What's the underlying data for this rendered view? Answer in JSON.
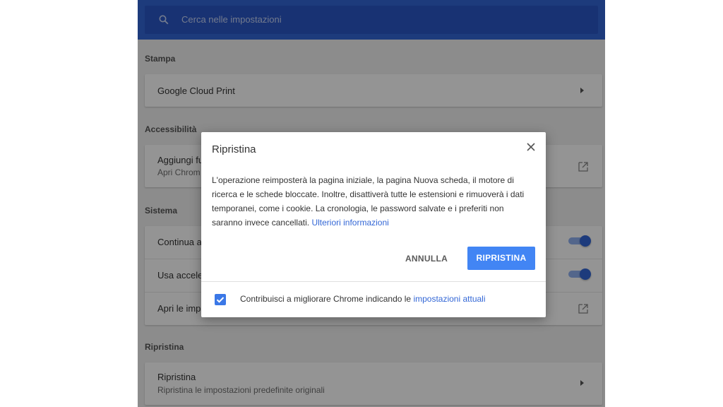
{
  "search": {
    "placeholder": "Cerca nelle impostazioni",
    "icon": "search-icon"
  },
  "sections": {
    "stampa": {
      "title": "Stampa",
      "rows": [
        {
          "label": "Google Cloud Print"
        }
      ]
    },
    "accessibilita": {
      "title": "Accessibilità",
      "rows": [
        {
          "label": "Aggiungi fu",
          "sub": "Apri Chrom"
        }
      ]
    },
    "sistema": {
      "title": "Sistema",
      "rows": [
        {
          "label": "Continua a"
        },
        {
          "label": "Usa accele"
        },
        {
          "label": "Apri le imp"
        }
      ]
    },
    "ripristina": {
      "title": "Ripristina",
      "rows": [
        {
          "label": "Ripristina",
          "sub": "Ripristina le impostazioni predefinite originali"
        }
      ]
    }
  },
  "dialog": {
    "title": "Ripristina",
    "body_lines": [
      "L'operazione reimposterà la pagina iniziale, la pagina Nuova scheda, il motore di",
      "ricerca e le schede bloccate. Inoltre, disattiverà tutte le estensioni e rimuoverà i dati",
      "temporanei, come i cookie. La cronologia, le password salvate e i preferiti non",
      "saranno invece cancellati."
    ],
    "learn_more": "Ulteriori informazioni",
    "cancel_label": "ANNULLA",
    "confirm_label": "RIPRISTINA",
    "checkbox_text": "Contribuisci a migliorare Chrome indicando le",
    "checkbox_link": "impostazioni attuali",
    "checkbox_checked": true
  },
  "colors": {
    "header": "#3367d6",
    "accent": "#4285f4",
    "link": "#3367d6"
  }
}
